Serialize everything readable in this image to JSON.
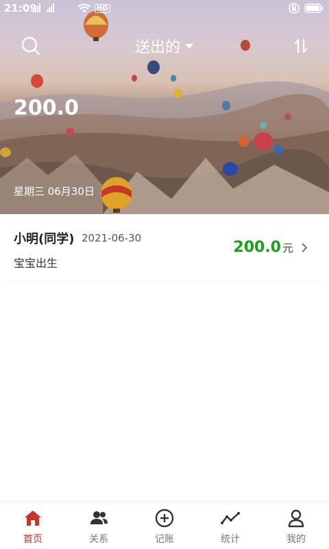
{
  "status_bar": {
    "time": "21:09",
    "network_labels": [
      "2G",
      "4G"
    ],
    "hd_label": "HD"
  },
  "header": {
    "title": "送出的",
    "search_icon": "search-icon",
    "dropdown_icon": "caret-down-icon",
    "sort_icon": "sort-arrows-icon"
  },
  "summary": {
    "total": "200.0",
    "date": "星期三 06月30日"
  },
  "records": [
    {
      "name": "小明(同学)",
      "date": "2021-06-30",
      "note": "宝宝出生",
      "amount": "200.0",
      "unit": "元"
    }
  ],
  "nav": {
    "items": [
      {
        "label": "首页",
        "icon": "home-icon",
        "active": true
      },
      {
        "label": "关系",
        "icon": "people-icon",
        "active": false
      },
      {
        "label": "记账",
        "icon": "add-circle-icon",
        "active": false
      },
      {
        "label": "统计",
        "icon": "trend-line-icon",
        "active": false
      },
      {
        "label": "我的",
        "icon": "user-icon",
        "active": false
      }
    ],
    "active_color": "#c8342a",
    "inactive_color": "#333333"
  },
  "colors": {
    "amount_green": "#1aa11a",
    "accent_red": "#c8342a"
  }
}
